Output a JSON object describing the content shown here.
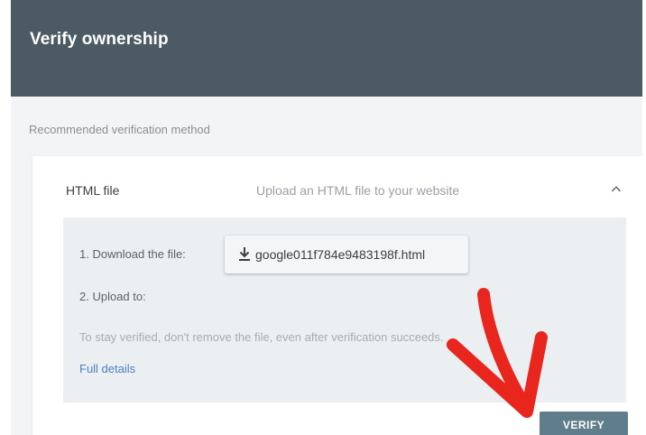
{
  "dialog": {
    "title": "Verify ownership",
    "section_label": "Recommended verification method"
  },
  "card": {
    "title": "HTML file",
    "description": "Upload an HTML file to your website",
    "steps": {
      "download_label": "1. Download the file:",
      "download_filename": "google011f784e9483198f.html",
      "upload_label": "2. Upload to:"
    },
    "note": "To stay verified, don't remove the file, even after verification succeeds.",
    "details_link": "Full details",
    "verify_button": "VERIFY"
  },
  "colors": {
    "header": "#4b5a63",
    "verify_button": "#607d8b",
    "link": "#4a7fc8",
    "annotation_arrow": "#e8261e"
  },
  "icons": [
    "chevron-up-icon",
    "download-icon"
  ]
}
